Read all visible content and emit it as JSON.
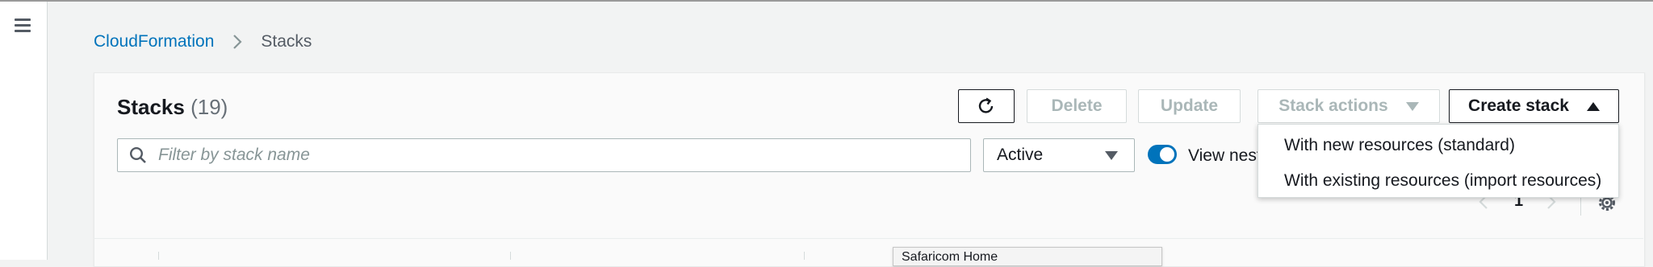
{
  "breadcrumb": {
    "root": "CloudFormation",
    "current": "Stacks"
  },
  "panel": {
    "title": "Stacks",
    "count": "(19)"
  },
  "toolbar": {
    "delete_label": "Delete",
    "update_label": "Update",
    "stack_actions_label": "Stack actions",
    "create_stack_label": "Create stack"
  },
  "filter": {
    "placeholder": "Filter by stack name",
    "status_value": "Active",
    "view_nested_label": "View nest",
    "view_nested_on": true
  },
  "create_menu": {
    "items": [
      "With new resources (standard)",
      "With existing resources (import resources)"
    ]
  },
  "pagination": {
    "current_page": "1"
  },
  "tooltip": {
    "text": "Safaricom Home"
  },
  "colors": {
    "link": "#0073bb",
    "toggle_on": "#0073bb",
    "disabled_text": "#aab7b8",
    "background": "#f2f3f3"
  },
  "icons": [
    "menu-icon",
    "chevron-right-icon",
    "refresh-icon",
    "search-icon",
    "caret-down-icon",
    "caret-up-icon",
    "chevron-left-icon",
    "gear-icon"
  ]
}
